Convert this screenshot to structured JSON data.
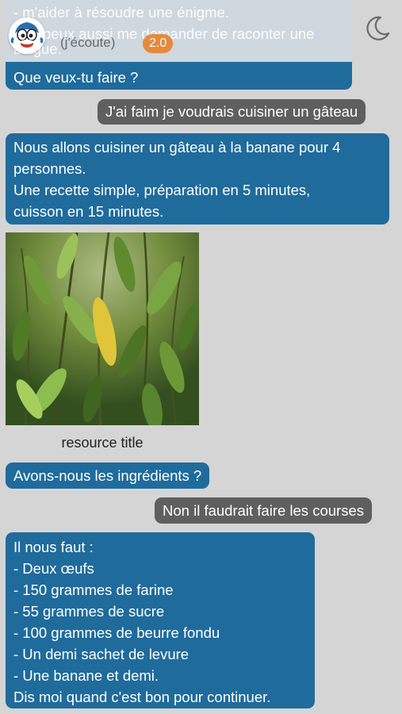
{
  "header": {
    "status": "(j'écoute)",
    "version": "2.0",
    "avatar_icon": "cartoon-face-icon",
    "theme_icon": "moon-icon"
  },
  "messages": {
    "top_partial_lines": [
      "- m'aider à résoudre une énigme.",
      "- Tu peux aussi me demander de raconter une",
      "blague."
    ],
    "top_question": "Que veux-tu faire ?",
    "user1": "J'ai faim je voudrais cuisiner un gâteau",
    "bot1_lines": [
      "Nous allons cuisiner un gâteau à la banane pour 4",
      "personnes.",
      "Une recette simple, préparation en 5 minutes,",
      "cuisson en 15 minutes."
    ],
    "resource_title": "resource title",
    "bot2": "Avons-nous les ingrédients ?",
    "user2": "Non il faudrait faire les courses",
    "bot3_lines": [
      "Il nous faut :",
      "- Deux œufs",
      "- 150 grammes de farine",
      "- 55 grammes de sucre",
      "- 100 grammes de beurre fondu",
      "- Un demi sachet de levure",
      "- Une banane et demi.",
      "Dis moi quand c'est bon pour continuer."
    ]
  },
  "colors": {
    "bot_bubble": "#1f6b9c",
    "user_bubble": "#5f5f5f",
    "badge": "#e58a3c",
    "background": "#d5d5d5"
  }
}
